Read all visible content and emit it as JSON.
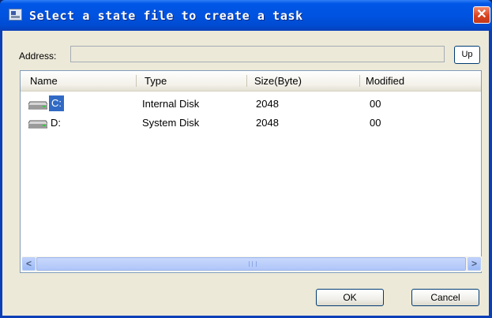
{
  "dialog": {
    "title": "Select a state file to create a task",
    "close_glyph": "✕"
  },
  "address": {
    "label": "Address:",
    "value": "",
    "up_label": "Up"
  },
  "file_list": {
    "columns": [
      "Name",
      "Type",
      "Size(Byte)",
      "Modified"
    ],
    "rows": [
      {
        "name": "C:",
        "type": "Internal Disk",
        "size": "2048",
        "modified": "00",
        "icon": "drive-icon",
        "selected": true
      },
      {
        "name": "D:",
        "type": "System Disk",
        "size": "2048",
        "modified": "00",
        "icon": "drive-icon",
        "selected": false
      }
    ]
  },
  "scrollbar": {
    "left_glyph": "<",
    "right_glyph": ">"
  },
  "buttons": {
    "ok_label": "OK",
    "cancel_label": "Cancel"
  },
  "colors": {
    "titlebar": "#0053e0",
    "selection": "#316ac5",
    "dialog_bg": "#ece9d8",
    "close_button": "#d9431f"
  }
}
